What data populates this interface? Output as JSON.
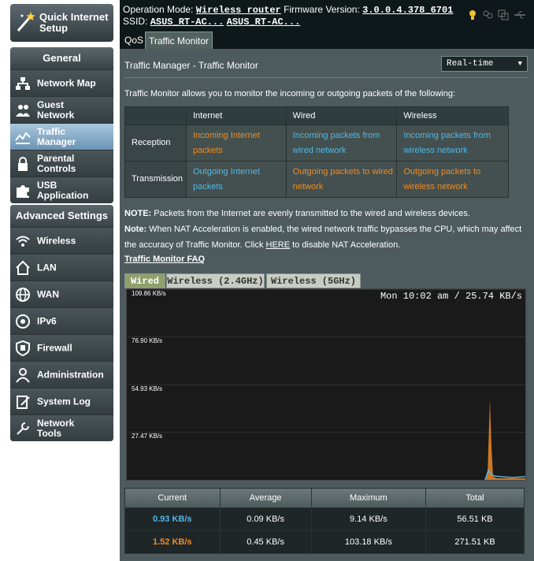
{
  "sidebar": {
    "qis_label": "Quick Internet Setup",
    "general_header": "General",
    "general_items": [
      {
        "label": "Network Map",
        "icon": "network-map-icon"
      },
      {
        "label": "Guest Network",
        "icon": "guest-network-icon"
      },
      {
        "label": "Traffic Manager",
        "icon": "traffic-manager-icon",
        "active": true
      },
      {
        "label": "Parental Controls",
        "icon": "lock-icon"
      },
      {
        "label": "USB Application",
        "icon": "puzzle-icon"
      }
    ],
    "advanced_header": "Advanced Settings",
    "advanced_items": [
      {
        "label": "Wireless",
        "icon": "wifi-icon"
      },
      {
        "label": "LAN",
        "icon": "home-icon"
      },
      {
        "label": "WAN",
        "icon": "globe-icon"
      },
      {
        "label": "IPv6",
        "icon": "ipv6-icon"
      },
      {
        "label": "Firewall",
        "icon": "shield-icon"
      },
      {
        "label": "Administration",
        "icon": "person-icon"
      },
      {
        "label": "System Log",
        "icon": "log-icon"
      },
      {
        "label": "Network Tools",
        "icon": "tools-icon"
      }
    ]
  },
  "topbar": {
    "mode_label": "Operation Mode:",
    "mode_value": "Wireless router",
    "fw_label": "Firmware Version:",
    "fw_value": "3.0.0.4.378_6701",
    "ssid_label": "SSID:",
    "ssid_1": "ASUS_RT-AC...",
    "ssid_2": "ASUS_RT-AC..."
  },
  "tabs": [
    "QoS",
    "Traffic Monitor"
  ],
  "panel": {
    "title": "Traffic Manager - Traffic Monitor",
    "view_select": "Real-time",
    "intro": "Traffic Monitor allows you to monitor the incoming or outgoing packets of the following:",
    "table": {
      "headers": [
        "Internet",
        "Wired",
        "Wireless"
      ],
      "rows": [
        {
          "label": "Reception",
          "cells": [
            "Incoming Internet packets",
            "Incoming packets from wired network",
            "Incoming packets from wireless network"
          ]
        },
        {
          "label": "Transmission",
          "cells": [
            "Outgoing Internet packets",
            "Outgoing packets to wired network",
            "Outgoing packets to wireless network"
          ]
        }
      ]
    },
    "note1_bold": "NOTE:",
    "note1": " Packets from the Internet are evenly transmitted to the wired and wireless devices.",
    "note2_bold": "Note:",
    "note2a": " When NAT Acceleration is enabled, the wired network traffic bypasses the CPU, which may affect the accuracy of Traffic Monitor. Click ",
    "note2_link": "HERE",
    "note2b": " to disable NAT Acceleration.",
    "faq": "Traffic Monitor FAQ"
  },
  "graph": {
    "tabs": [
      "Wired",
      "Wireless (2.4GHz)",
      "Wireless (5GHz)"
    ],
    "time_label": "Mon 10:02 am / 25.74 KB/s",
    "y_labels": [
      "109.86 KB/s",
      "76.90 KB/s",
      "54.93 KB/s",
      "27.47 KB/s"
    ],
    "colors": {
      "reception": "#f08a24",
      "transmission": "#52b7e8"
    }
  },
  "stats": {
    "headers": [
      "Current",
      "Average",
      "Maximum",
      "Total"
    ],
    "rows": [
      {
        "current": "0.93 KB/s",
        "average": "0.09 KB/s",
        "maximum": "9.14 KB/s",
        "total": "56.51 KB",
        "color": "blue"
      },
      {
        "current": "1.52 KB/s",
        "average": "0.45 KB/s",
        "maximum": "103.18 KB/s",
        "total": "271.51 KB",
        "color": "orange"
      }
    ]
  }
}
